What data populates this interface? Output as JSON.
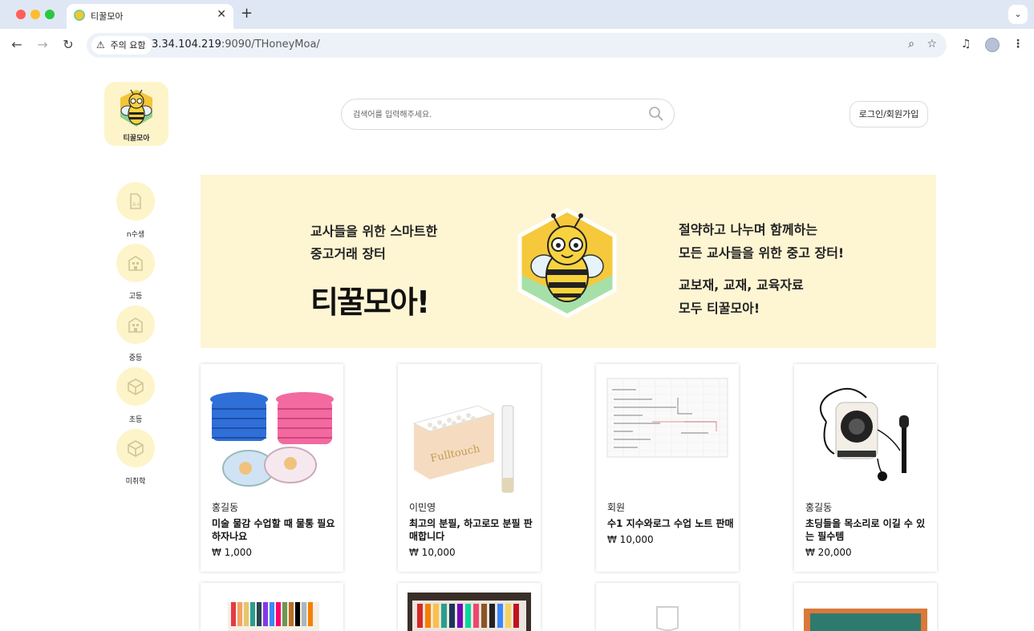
{
  "browser": {
    "tab_title": "티꿀모아",
    "new_tab": "+",
    "close": "✕",
    "security_label": "주의 요함",
    "url_host": "3.34.104.219",
    "url_rest": ":9090/THoneyMoa/"
  },
  "header": {
    "logo_text": "티꿀모아",
    "search_placeholder": "검색어를 입력해주세요.",
    "login_label": "로그인/회원가입"
  },
  "side_nav": [
    {
      "label": "n수생",
      "icon": "document-icon"
    },
    {
      "label": "고등",
      "icon": "building-icon"
    },
    {
      "label": "중등",
      "icon": "building-icon"
    },
    {
      "label": "초등",
      "icon": "cube-icon"
    },
    {
      "label": "미취학",
      "icon": "cube-icon"
    }
  ],
  "banner": {
    "left_line1": "교사들을 위한 스마트한",
    "left_line2": "중고거래 장터",
    "big_title": "티꿀모아!",
    "right_line1": "절약하고 나누며 함께하는",
    "right_line2": "모든 교사들을 위한 중고 장터!",
    "right_line3": "교보재, 교재, 교육자료",
    "right_line4": "모두 티꿀모아!"
  },
  "products": [
    {
      "seller": "홍길동",
      "title": "미술 물감 수업할 때 물통 필요하자나요",
      "price": "₩ 1,000",
      "image": "collapsible-water-cup-photo"
    },
    {
      "seller": "이민영",
      "title": "최고의 분필, 하고로모 분필 판매합니다",
      "price": "₩ 10,000",
      "image": "chalk-box-photo"
    },
    {
      "seller": "회원",
      "title": "수1 지수와로그 수업 노트 판매",
      "price": "₩ 10,000",
      "image": "lecture-note-photo"
    },
    {
      "seller": "홍길동",
      "title": "초딩들을 목소리로 이길 수 있는 필수템",
      "price": "₩ 20,000",
      "image": "voice-amplifier-photo"
    }
  ],
  "colors": {
    "accent_yellow": "#fef5d3",
    "circle_yellow": "#fdf4c9",
    "chrome_blue": "#dfe7f5"
  }
}
